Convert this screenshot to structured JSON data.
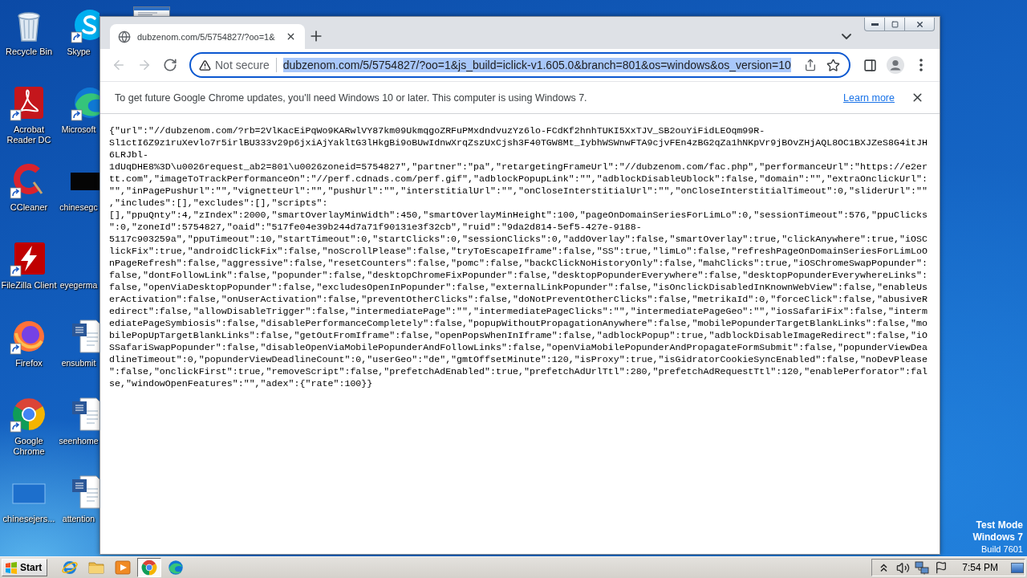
{
  "desktop": {
    "columns": [
      [
        {
          "kind": "recycle-bin",
          "label": "Recycle Bin",
          "shortcut": false
        },
        {
          "kind": "acrobat",
          "label": "Acrobat Reader DC",
          "shortcut": true
        },
        {
          "kind": "ccleaner",
          "label": "CCleaner",
          "shortcut": true
        },
        {
          "kind": "filezilla",
          "label": "FileZilla Client",
          "shortcut": true
        },
        {
          "kind": "firefox",
          "label": "Firefox",
          "shortcut": true
        },
        {
          "kind": "chrome",
          "label": "Google Chrome",
          "shortcut": true
        },
        {
          "kind": "blank-file",
          "label": "chinesejers...",
          "shortcut": false
        }
      ],
      [
        {
          "kind": "skype",
          "label": "Skype",
          "shortcut": true
        },
        {
          "kind": "edge",
          "label": "Microsoft",
          "shortcut": true
        },
        {
          "kind": "thumbnail",
          "label": "chinesegc",
          "shortcut": false
        },
        {
          "label": "eyegerma"
        },
        {
          "kind": "word",
          "label": "ensubmit",
          "shortcut": false
        },
        {
          "kind": "word",
          "label": "seenhome",
          "shortcut": false
        },
        {
          "kind": "word",
          "label": "attention",
          "shortcut": false
        }
      ],
      [
        {
          "kind": "document"
        }
      ]
    ],
    "os_notice": {
      "title": "Test Mode",
      "edition": "Windows 7",
      "build": "Build 7601"
    }
  },
  "browser": {
    "tabs": [
      {
        "title": "dubzenom.com/5/5754827/?oo=1&",
        "selected": true
      }
    ],
    "nav_buttons": [
      {
        "kind": "back",
        "disabled": true
      },
      {
        "kind": "forward",
        "disabled": true
      },
      {
        "kind": "reload",
        "disabled": false
      }
    ],
    "address_bar": {
      "security": "Not secure",
      "url": "dubzenom.com/5/5754827/?oo=1&js_build=iclick-v1.605.0&branch=801&os=windows&os_version=10",
      "selected": true
    },
    "infobar": {
      "message": "To get future Google Chrome updates, you'll need Windows 10 or later. This computer is using Windows 7.",
      "link": "Learn more"
    },
    "page": {
      "lines": [
        "{\"url\":\"//dubzenom.com/?rb=2VlKacEiPqWo9KARwlVY87km09UkmqgoZRFuPMxdndvuzYz6lo-FCdKf2hnhTUKI5XxTJV_SB2ouYiFidLEOqm99R-",
        "Sl1ctI6Z9z1ruXevlo7r5irlBU333v29p6jxiAjYakltG3lHkgBi9oBUwIdnwXrqZszUxCjsh3F40TGW8Mt_IybhWSWnwFTA9cjvFEn4zBG2qZa1hNKpVr9jBOvZHjAQL8OC1BXJZeS8G4itJH",
        "6LRJbl-",
        "1dUqDHE8%3D\\u0026request_ab2=801\\u0026zoneid=5754827\",\"partner\":\"pa\",\"retargetingFrameUrl\":\"//dubzenom.com/fac.php\",\"performanceUrl\":\"https://e2er",
        "tt.com\",\"imageToTrackPerformanceOn\":\"//perf.cdnads.com/perf.gif\",\"adblockPopupLink\":\"\",\"adblockDisableUblock\":false,\"domain\":\"\",\"extraOnclickUrl\":",
        "\"\",\"inPagePushUrl\":\"\",\"vignetteUrl\":\"\",\"pushUrl\":\"\",\"interstitialUrl\":\"\",\"onCloseInterstitialUrl\":\"\",\"onCloseInterstitialTimeout\":0,\"sliderUrl\":\"\"",
        ",\"includes\":[],\"excludes\":[],\"scripts\":",
        "[],\"ppuQnty\":4,\"zIndex\":2000,\"smartOverlayMinWidth\":450,\"smartOverlayMinHeight\":100,\"pageOnDomainSeriesForLimLo\":0,\"sessionTimeout\":576,\"ppuClicks",
        "\":0,\"zoneId\":5754827,\"oaid\":\"517fe04e39b244d7a71f90131e3f32cb\",\"ruid\":\"9da2d814-5ef5-427e-9188-",
        "5117c903259a\",\"ppuTimeout\":10,\"startTimeout\":0,\"startClicks\":0,\"sessionClicks\":0,\"addOverlay\":false,\"smartOverlay\":true,\"clickAnywhere\":true,\"iOSC",
        "lickFix\":true,\"androidClickFix\":false,\"noScrollPlease\":false,\"tryToEscapeIframe\":false,\"SS\":true,\"limLo\":false,\"refreshPageOnDomainSeriesForLimLoO",
        "nPageRefresh\":false,\"aggressive\":false,\"resetCounters\":false,\"pomc\":false,\"backClickNoHistoryOnly\":false,\"mahClicks\":true,\"iOSChromeSwapPopunder\":",
        "false,\"dontFollowLink\":false,\"popunder\":false,\"desktopChromeFixPopunder\":false,\"desktopPopunderEverywhere\":false,\"desktopPopunderEverywhereLinks\":",
        "false,\"openViaDesktopPopunder\":false,\"excludesOpenInPopunder\":false,\"externalLinkPopunder\":false,\"isOnclickDisabledInKnownWebView\":false,\"enableUs",
        "erActivation\":false,\"onUserActivation\":false,\"preventOtherClicks\":false,\"doNotPreventOtherClicks\":false,\"metrikaId\":0,\"forceClick\":false,\"abusiveR",
        "edirect\":false,\"allowDisableTrigger\":false,\"intermediatePage\":\"\",\"intermediatePageClicks\":\"\",\"intermediatePageGeo\":\"\",\"iosSafariFix\":false,\"interm",
        "ediatePageSymbiosis\":false,\"disablePerformanceCompletely\":false,\"popupWithoutPropagationAnywhere\":false,\"mobilePopunderTargetBlankLinks\":false,\"mo",
        "bilePopUpTargetBlankLinks\":false,\"getOutFromIframe\":false,\"openPopsWhenInIframe\":false,\"adblockPopup\":true,\"adblockDisableImageRedirect\":false,\"iO",
        "SSafariSwapPopunder\":false,\"disableOpenViaMobilePopunderAndFollowLinks\":false,\"openViaMobilePopunderAndPropagateFormSubmit\":false,\"popunderViewDea",
        "dlineTimeout\":0,\"popunderViewDeadlineCount\":0,\"userGeo\":\"de\",\"gmtOffsetMinute\":120,\"isProxy\":true,\"isGidratorCookieSyncEnabled\":false,\"noDevPlease",
        "\":false,\"onclickFirst\":true,\"removeScript\":false,\"prefetchAdEnabled\":true,\"prefetchAdUrlTtl\":280,\"prefetchAdRequestTtl\":120,\"enablePerforator\":fal",
        "se,\"windowOpenFeatures\":\"\",\"adex\":{\"rate\":100}}"
      ]
    }
  },
  "taskbar": {
    "start": "Start",
    "apps": [
      {
        "kind": "internet-explorer",
        "selected": false
      },
      {
        "kind": "explorer",
        "selected": false
      },
      {
        "kind": "media-player",
        "selected": false
      },
      {
        "kind": "chrome",
        "selected": true
      },
      {
        "kind": "edge",
        "selected": false
      }
    ],
    "tray": [
      {
        "kind": "show-hidden"
      },
      {
        "kind": "volume"
      },
      {
        "kind": "network"
      },
      {
        "kind": "action-center"
      }
    ],
    "time": "7:54 PM"
  }
}
